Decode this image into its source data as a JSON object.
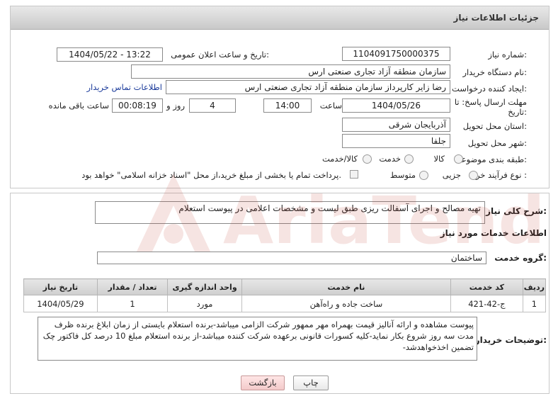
{
  "header": {
    "title": "جزئیات اطلاعات نیاز"
  },
  "fields": {
    "need_number_label": "شماره نیاز:",
    "need_number": "1104091750000375",
    "announce_label": "تاریخ و ساعت اعلان عمومی:",
    "announce_value": "1404/05/22 - 13:22",
    "buyer_org_label": "نام دستگاه خریدار:",
    "buyer_org": "سازمان منطقه آزاد تجاری صنعتی ارس",
    "creator_label": "ایجاد کننده درخواست:",
    "creator": "رضا زایر کارپرداز سازمان منطقه آزاد تجاری صنعتی ارس",
    "contact_link": "اطلاعات تماس خریدار",
    "deadline_label_1": "مهلت ارسال پاسخ: تا",
    "deadline_label_2": "تاریخ:",
    "deadline_date": "1404/05/26",
    "time_label": "ساعت",
    "deadline_time": "14:00",
    "days_value": "4",
    "days_label": "روز و",
    "remaining_value": "00:08:19",
    "remaining_label": "ساعت باقی مانده",
    "province_label": "استان محل تحویل:",
    "province": "آذربایجان شرقی",
    "city_label": "شهر محل تحویل:",
    "city": "جلفا",
    "category_label": "طبقه بندی موضوعی:",
    "category_options": [
      "کالا",
      "خدمت",
      "کالا/خدمت"
    ],
    "process_label": "نوع فرآیند خرید :",
    "process_options": [
      "جزیی",
      "متوسط"
    ],
    "payment_note": "پرداخت تمام یا بخشی از مبلغ خرید،از محل \"اسناد خزانه اسلامی\" خواهد بود."
  },
  "summary": {
    "label": "شرح کلی نیاز:",
    "text": "تهیه مصالح و اجرای آسفالت ریزی طبق لیست و مشخصات اعلامی در پیوست استعلام"
  },
  "services": {
    "section_title": "اطلاعات خدمات مورد نیاز",
    "group_label": "گروه خدمت:",
    "group_value": "ساختمان",
    "columns": [
      "ردیف",
      "کد خدمت",
      "نام خدمت",
      "واحد اندازه گیری",
      "تعداد / مقدار",
      "تاریخ نیاز"
    ],
    "rows": [
      [
        "1",
        "ج-42-421",
        "ساخت جاده و راه‌آهن",
        "مورد",
        "1",
        "1404/05/29"
      ]
    ]
  },
  "buyer_notes": {
    "label": "توضیحات خریدار:",
    "text": "پیوست مشاهده و ارائه آنالیز قیمت بهمراه مهر ممهور شرکت الزامی میباشد-برنده استعلام بایستی از زمان ابلاغ برنده ظرف مدت سه روز شروع بکار نماید-کلیه کسورات قانونی برعهده شرکت کننده میباشد-از برنده استعلام مبلغ 10 درصد کل فاکتور چک تضمین اخذخواهدشد-"
  },
  "buttons": {
    "print": "چاپ",
    "back": "بازگشت"
  },
  "watermark": {
    "text": "AriaTender.neT"
  },
  "colors": {
    "link": "#1a3a9a",
    "watermark": "#c0392b"
  }
}
